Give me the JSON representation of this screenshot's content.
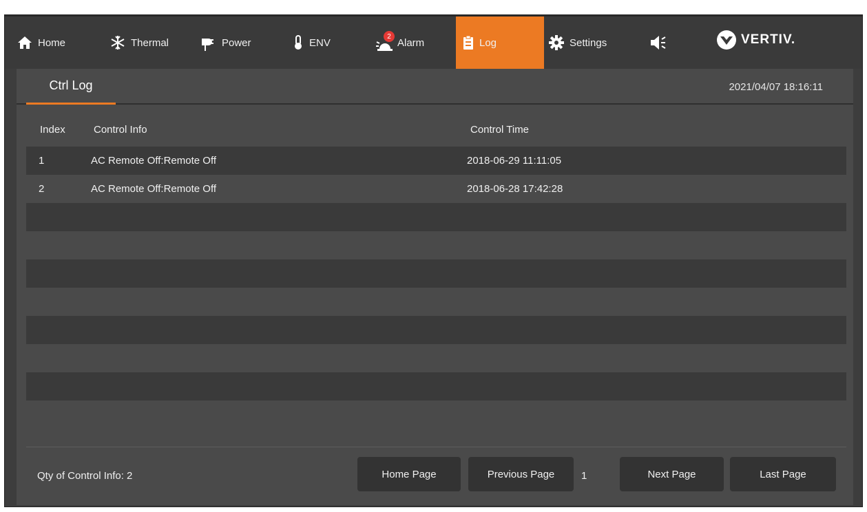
{
  "nav": {
    "items": [
      {
        "label": "Home",
        "icon": "home-icon"
      },
      {
        "label": "Thermal",
        "icon": "snowflake-icon"
      },
      {
        "label": "Power",
        "icon": "power-plug-icon"
      },
      {
        "label": "ENV",
        "icon": "thermometer-icon"
      },
      {
        "label": "Alarm",
        "icon": "alarm-light-icon",
        "badge": "2"
      },
      {
        "label": "Log",
        "icon": "clipboard-icon",
        "active": true
      },
      {
        "label": "Settings",
        "icon": "gear-icon"
      }
    ],
    "sound_icon": "speaker-icon",
    "logo_text": "VERTIV."
  },
  "panel": {
    "tab_label": "Ctrl Log",
    "datetime": "2021/04/07 18:16:11"
  },
  "table": {
    "headers": [
      "Index",
      "Control Info",
      "Control Time"
    ],
    "rows": [
      {
        "index": "1",
        "info": "AC Remote Off:Remote Off",
        "time": "2018-06-29 11:11:05"
      },
      {
        "index": "2",
        "info": "AC Remote Off:Remote Off",
        "time": "2018-06-28 17:42:28"
      }
    ]
  },
  "footer": {
    "qty_label": "Qty of Control Info:  2",
    "home_page": "Home Page",
    "previous_page": "Previous Page",
    "page_number": "1",
    "next_page": "Next Page",
    "last_page": "Last Page"
  },
  "colors": {
    "accent": "#ec7a23",
    "panel_bg": "#4a4a4a",
    "frame_bg": "#3d3d3d",
    "badge": "#e53935"
  }
}
